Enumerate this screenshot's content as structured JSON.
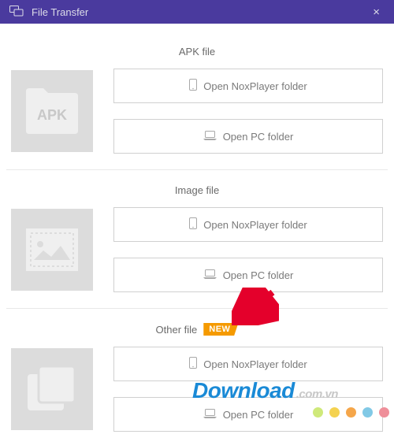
{
  "titlebar": {
    "title": "File Transfer",
    "close": "×"
  },
  "sections": [
    {
      "header": "APK file",
      "badge": null,
      "icon": "apk",
      "btn_nox": "Open NoxPlayer folder",
      "btn_pc": "Open PC folder"
    },
    {
      "header": "Image file",
      "badge": null,
      "icon": "image",
      "btn_nox": "Open NoxPlayer folder",
      "btn_pc": "Open PC folder"
    },
    {
      "header": "Other file",
      "badge": "NEW",
      "icon": "other",
      "btn_nox": "Open NoxPlayer folder",
      "btn_pc": "Open PC folder"
    }
  ],
  "watermark": {
    "main": "Download",
    "suffix": ".com.vn"
  },
  "colors": {
    "titlebar": "#4a3a9e",
    "badge": "#f59a00",
    "dots": [
      "#cfe97a",
      "#f4d250",
      "#f5a64a",
      "#81c9e6",
      "#ef8f9a"
    ]
  }
}
